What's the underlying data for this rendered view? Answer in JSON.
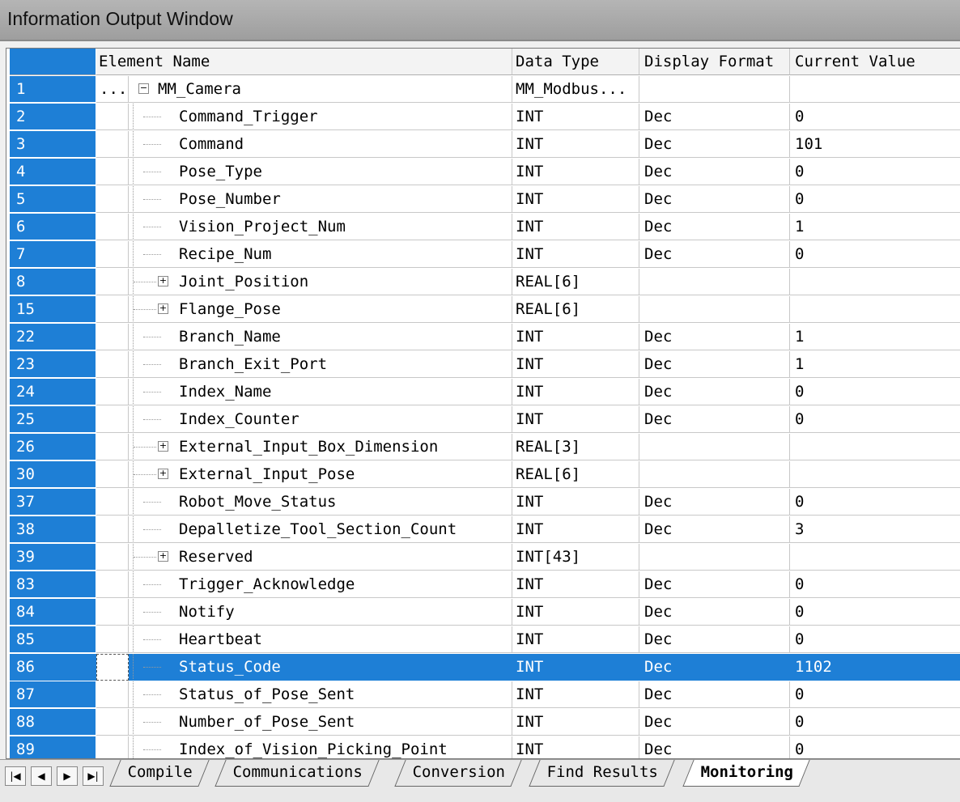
{
  "window": {
    "title": "Information Output Window"
  },
  "columns": {
    "element_name": "Element Name",
    "data_type": "Data Type",
    "display_format": "Display Format",
    "current_value": "Current Value"
  },
  "rows": [
    {
      "num": "1",
      "name": "MM_Camera",
      "type": "MM_Modbus...",
      "fmt": "",
      "val": "",
      "expander": "minus",
      "gutter": "..."
    },
    {
      "num": "2",
      "name": "Command_Trigger",
      "type": "INT",
      "fmt": "Dec",
      "val": "0"
    },
    {
      "num": "3",
      "name": "Command",
      "type": "INT",
      "fmt": "Dec",
      "val": "101"
    },
    {
      "num": "4",
      "name": "Pose_Type",
      "type": "INT",
      "fmt": "Dec",
      "val": "0"
    },
    {
      "num": "5",
      "name": "Pose_Number",
      "type": "INT",
      "fmt": "Dec",
      "val": "0"
    },
    {
      "num": "6",
      "name": "Vision_Project_Num",
      "type": "INT",
      "fmt": "Dec",
      "val": "1"
    },
    {
      "num": "7",
      "name": "Recipe_Num",
      "type": "INT",
      "fmt": "Dec",
      "val": "0"
    },
    {
      "num": "8",
      "name": "Joint_Position",
      "type": "REAL[6]",
      "fmt": "",
      "val": "",
      "expander": "plus"
    },
    {
      "num": "15",
      "name": "Flange_Pose",
      "type": "REAL[6]",
      "fmt": "",
      "val": "",
      "expander": "plus"
    },
    {
      "num": "22",
      "name": "Branch_Name",
      "type": "INT",
      "fmt": "Dec",
      "val": "1"
    },
    {
      "num": "23",
      "name": "Branch_Exit_Port",
      "type": "INT",
      "fmt": "Dec",
      "val": "1"
    },
    {
      "num": "24",
      "name": "Index_Name",
      "type": "INT",
      "fmt": "Dec",
      "val": "0"
    },
    {
      "num": "25",
      "name": "Index_Counter",
      "type": "INT",
      "fmt": "Dec",
      "val": "0"
    },
    {
      "num": "26",
      "name": "External_Input_Box_Dimension",
      "type": "REAL[3]",
      "fmt": "",
      "val": "",
      "expander": "plus"
    },
    {
      "num": "30",
      "name": "External_Input_Pose",
      "type": "REAL[6]",
      "fmt": "",
      "val": "",
      "expander": "plus"
    },
    {
      "num": "37",
      "name": "Robot_Move_Status",
      "type": "INT",
      "fmt": "Dec",
      "val": "0"
    },
    {
      "num": "38",
      "name": "Depalletize_Tool_Section_Count",
      "type": "INT",
      "fmt": "Dec",
      "val": "3"
    },
    {
      "num": "39",
      "name": "Reserved",
      "type": "INT[43]",
      "fmt": "",
      "val": "",
      "expander": "plus"
    },
    {
      "num": "83",
      "name": "Trigger_Acknowledge",
      "type": "INT",
      "fmt": "Dec",
      "val": "0"
    },
    {
      "num": "84",
      "name": "Notify",
      "type": "INT",
      "fmt": "Dec",
      "val": "0"
    },
    {
      "num": "85",
      "name": "Heartbeat",
      "type": "INT",
      "fmt": "Dec",
      "val": "0"
    },
    {
      "num": "86",
      "name": "Status_Code",
      "type": "INT",
      "fmt": "Dec",
      "val": "1102",
      "selected": true
    },
    {
      "num": "87",
      "name": "Status_of_Pose_Sent",
      "type": "INT",
      "fmt": "Dec",
      "val": "0"
    },
    {
      "num": "88",
      "name": "Number_of_Pose_Sent",
      "type": "INT",
      "fmt": "Dec",
      "val": "0"
    },
    {
      "num": "89",
      "name": "Index_of_Vision_Picking_Point",
      "type": "INT",
      "fmt": "Dec",
      "val": "0"
    }
  ],
  "tabs": [
    {
      "label": "Compile",
      "active": false
    },
    {
      "label": "Communications",
      "active": false
    },
    {
      "label": "Conversion",
      "active": false
    },
    {
      "label": "Find Results",
      "active": false
    },
    {
      "label": "Monitoring",
      "active": true
    }
  ],
  "nav_icons": [
    "first-tab-icon",
    "prev-tab-icon",
    "next-tab-icon",
    "last-tab-icon"
  ]
}
